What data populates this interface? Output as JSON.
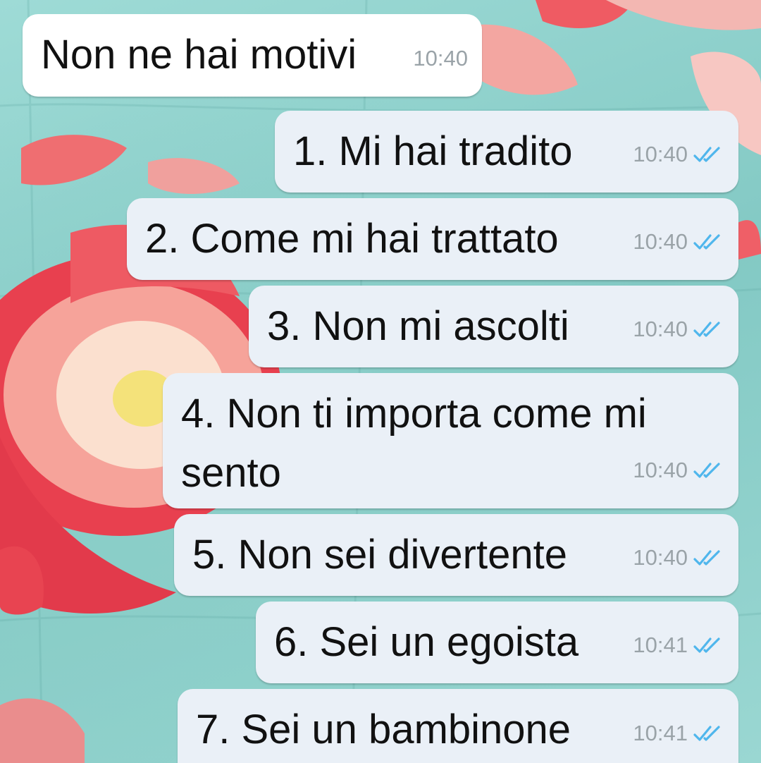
{
  "chat": {
    "messages": [
      {
        "direction": "incoming",
        "text": "Non ne hai motivi",
        "time": "10:40"
      },
      {
        "direction": "outgoing",
        "text": "1. Mi hai tradito",
        "time": "10:40",
        "status": "read"
      },
      {
        "direction": "outgoing",
        "text": "2. Come mi hai trattato",
        "time": "10:40",
        "status": "read"
      },
      {
        "direction": "outgoing",
        "text": "3. Non mi ascolti",
        "time": "10:40",
        "status": "read"
      },
      {
        "direction": "outgoing",
        "text_line1": "4. Non ti importa come mi",
        "text_line2": "sento",
        "time": "10:40",
        "status": "read"
      },
      {
        "direction": "outgoing",
        "text": "5. Non sei divertente",
        "time": "10:40",
        "status": "read"
      },
      {
        "direction": "outgoing",
        "text": "6. Sei un egoista",
        "time": "10:41",
        "status": "read"
      },
      {
        "direction": "outgoing",
        "text": "7. Sei un bambinone",
        "time": "10:41",
        "status": "read"
      }
    ]
  },
  "colors": {
    "outgoing_bubble": "#eaf0f7",
    "incoming_bubble": "#ffffff",
    "read_ticks": "#4fb6ec",
    "wallpaper": "#8fd3cf"
  },
  "icons": {
    "read_status": "double-check-icon"
  }
}
